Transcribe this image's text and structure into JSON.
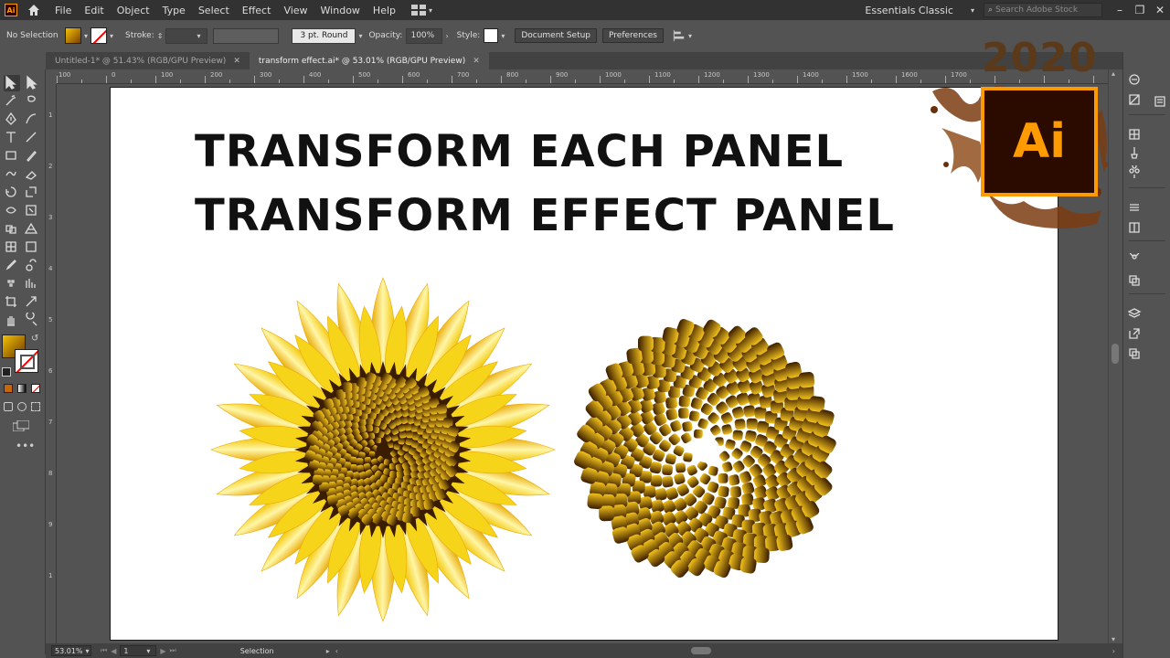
{
  "app": {
    "logo_text": "Ai",
    "menus": [
      "File",
      "Edit",
      "Object",
      "Type",
      "Select",
      "Effect",
      "View",
      "Window",
      "Help"
    ],
    "workspace": "Essentials Classic",
    "search_placeholder": "Search Adobe Stock"
  },
  "control_bar": {
    "selection": "No Selection",
    "stroke_label": "Stroke:",
    "brush": "3 pt. Round",
    "opacity_label": "Opacity:",
    "opacity_value": "100%",
    "style_label": "Style:",
    "document_setup": "Document Setup",
    "preferences": "Preferences"
  },
  "tabs": [
    {
      "label": "Untitled-1* @ 51.43% (RGB/GPU Preview)",
      "active": false
    },
    {
      "label": "transform effect.ai* @ 53.01% (RGB/GPU Preview)",
      "active": true
    }
  ],
  "ruler_h": [
    "100",
    "0",
    "100",
    "200",
    "300",
    "400",
    "500",
    "600",
    "700",
    "800",
    "900",
    "1000",
    "1100",
    "1200",
    "1300",
    "1400",
    "1500",
    "1600",
    "1700"
  ],
  "ruler_v": [
    "1",
    "2",
    "3",
    "4",
    "5",
    "6",
    "7",
    "8",
    "9",
    "1"
  ],
  "artboard": {
    "line1": "TRANSFORM EACH PANEL",
    "line2": "TRANSFORM EFFECT PANEL"
  },
  "badge": {
    "year": "2020",
    "logo": "Ai"
  },
  "status_bar": {
    "zoom": "53.01%",
    "artboard_num": "1",
    "tool": "Selection"
  },
  "colors": {
    "petal_light": "#fff6a8",
    "petal_mid": "#f6d41a",
    "petal_dark": "#e8a800",
    "seed_light": "#f2c11c",
    "seed_dark": "#3a1c00",
    "ai_orange": "#ff9a00",
    "ai_bg": "#2b0a00"
  }
}
